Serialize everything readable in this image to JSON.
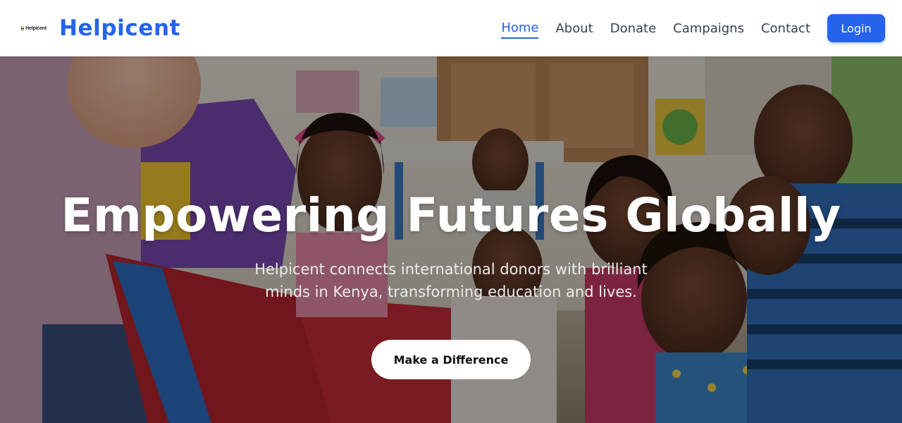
{
  "header": {
    "logo_text": "Helpicent",
    "brand_name": "Helpicent",
    "nav_items": [
      {
        "label": "Home",
        "active": true
      },
      {
        "label": "About",
        "active": false
      },
      {
        "label": "Donate",
        "active": false
      },
      {
        "label": "Campaigns",
        "active": false
      },
      {
        "label": "Contact",
        "active": false
      }
    ],
    "login_label": "Login"
  },
  "hero": {
    "title": "Empowering Futures Globally",
    "subtitle": "Helpicent connects international donors with brilliant minds in Kenya, transforming education and lives.",
    "cta_label": "Make a Difference",
    "background_image": "children-reading-classroom-photo"
  },
  "colors": {
    "brand": "#2563eb",
    "nav_text": "#374151",
    "white": "#ffffff"
  }
}
